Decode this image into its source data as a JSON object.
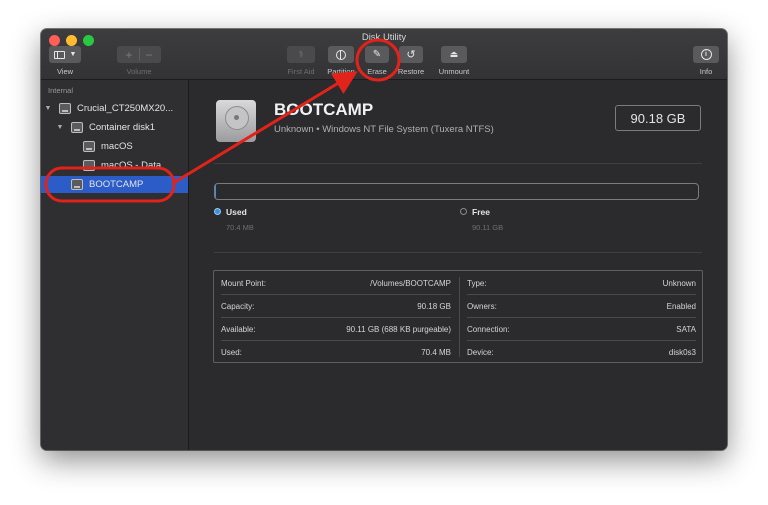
{
  "window": {
    "title": "Disk Utility"
  },
  "toolbar": {
    "view_label": "View",
    "volume_label": "Volume",
    "first_aid_label": "First Aid",
    "partition_label": "Partition",
    "erase_label": "Erase",
    "restore_label": "Restore",
    "unmount_label": "Unmount",
    "info_label": "Info"
  },
  "sidebar": {
    "section": "Internal",
    "items": [
      {
        "label": "Crucial_CT250MX20...",
        "level": 0
      },
      {
        "label": "Container disk1",
        "level": 1
      },
      {
        "label": "macOS",
        "level": 2
      },
      {
        "label": "macOS - Data",
        "level": 2
      },
      {
        "label": "BOOTCAMP",
        "level": 0,
        "selected": true
      }
    ]
  },
  "volume": {
    "name": "BOOTCAMP",
    "subtitle": "Unknown • Windows NT File System (Tuxera NTFS)",
    "size": "90.18 GB"
  },
  "usage": {
    "used_fraction": 0.001,
    "used_label": "Used",
    "used_value": "70.4 MB",
    "free_label": "Free",
    "free_value": "90.11 GB",
    "used_color": "#3b8fe0"
  },
  "details": {
    "left": [
      {
        "key": "Mount Point:",
        "value": "/Volumes/BOOTCAMP"
      },
      {
        "key": "Capacity:",
        "value": "90.18 GB"
      },
      {
        "key": "Available:",
        "value": "90.11 GB (688 KB purgeable)"
      },
      {
        "key": "Used:",
        "value": "70.4 MB"
      }
    ],
    "right": [
      {
        "key": "Type:",
        "value": "Unknown"
      },
      {
        "key": "Owners:",
        "value": "Enabled"
      },
      {
        "key": "Connection:",
        "value": "SATA"
      },
      {
        "key": "Device:",
        "value": "disk0s3"
      }
    ]
  },
  "annotation_color": "#e2231a"
}
